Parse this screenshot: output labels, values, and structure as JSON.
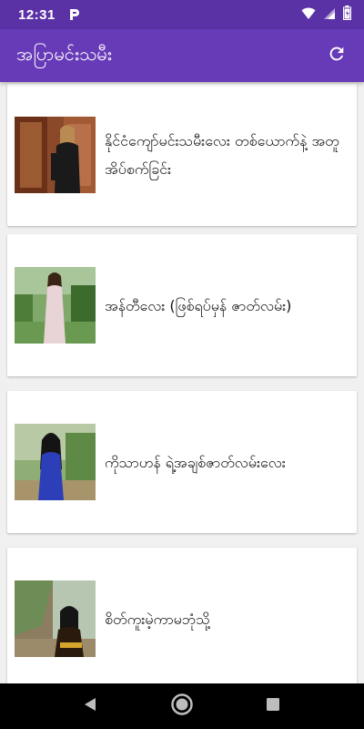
{
  "status_bar": {
    "time": "12:31",
    "app_notification_icon": "p-app-icon",
    "icons": [
      "wifi-icon",
      "signal-icon",
      "battery-icon"
    ]
  },
  "app_bar": {
    "title": "အပြာမင်းသမီး",
    "refresh_icon": "refresh-icon"
  },
  "articles": [
    {
      "title": "နိုင်ငံကျော်မင်းသမီးလေး တစ်ယောက်နဲ့ အတူအိပ်စက်ခြင်း",
      "thumbnail": "woman-in-doorway-photo"
    },
    {
      "title": "အန်တီလေး (ဖြစ်ရပ်မှန် ဇာတ်လမ်း)",
      "thumbnail": "woman-in-garden-photo"
    },
    {
      "title": "ကိုသာဟန် ရဲ့အချစ်ဇာတ်လမ်းလေး",
      "thumbnail": "woman-blue-dress-photo"
    },
    {
      "title": "စိတ်ကူးမဲ့ကာမဘုံသို့",
      "thumbnail": "woman-under-tree-photo"
    }
  ],
  "nav_bar": {
    "back_icon": "back-icon",
    "home_icon": "home-icon",
    "recents_icon": "recents-icon"
  },
  "colors": {
    "status_bar": "#5b31a6",
    "app_bar": "#673ab7"
  }
}
